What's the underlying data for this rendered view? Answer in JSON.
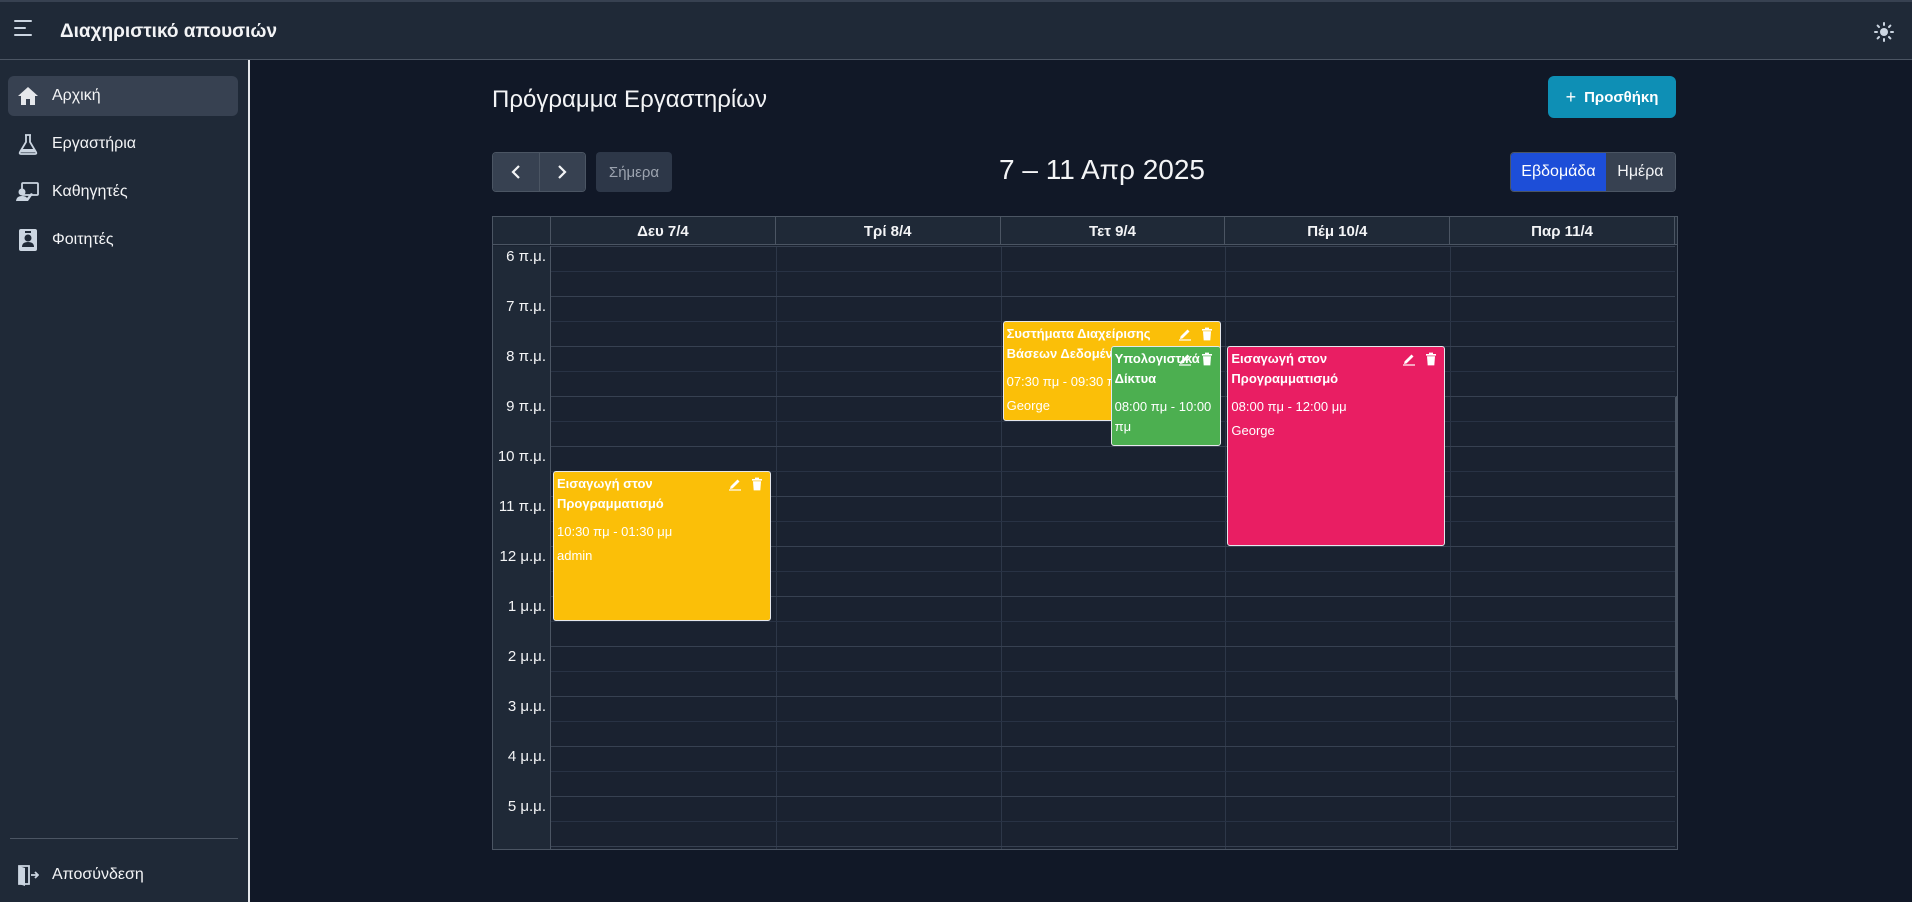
{
  "appbar": {
    "title": "Διαχηριστικό απουσιών",
    "menu_icon": "menu-icon",
    "theme_icon": "sun-icon"
  },
  "sidebar": {
    "items": [
      {
        "label": "Αρχική",
        "icon": "home-icon",
        "active": true
      },
      {
        "label": "Εργαστήρια",
        "icon": "flask-icon",
        "active": false
      },
      {
        "label": "Καθηγητές",
        "icon": "teacher-icon",
        "active": false
      },
      {
        "label": "Φοιτητές",
        "icon": "student-badge-icon",
        "active": false
      }
    ],
    "logout": {
      "label": "Αποσύνδεση",
      "icon": "logout-icon"
    }
  },
  "main": {
    "title": "Πρόγραμμα Εργαστηρίων",
    "add_button": "Προσθήκη",
    "today_button": "Σήμερα",
    "range": "7 – 11 Απρ 2025",
    "views": {
      "week": "Εβδομάδα",
      "day": "Ημέρα",
      "active": "week"
    }
  },
  "calendar": {
    "days": [
      "Δευ 7/4",
      "Τρί 8/4",
      "Τετ 9/4",
      "Πέμ 10/4",
      "Παρ 11/4"
    ],
    "hours": [
      "6 π.μ.",
      "7 π.μ.",
      "8 π.μ.",
      "9 π.μ.",
      "10 π.μ.",
      "11 π.μ.",
      "12 μ.μ.",
      "1 μ.μ.",
      "2 μ.μ.",
      "3 μ.μ.",
      "4 μ.μ.",
      "5 μ.μ."
    ],
    "events": [
      {
        "title": "Εισαγωγή στον Προγραμματισμό",
        "time": "10:30 πμ - 01:30 μμ",
        "who": "admin",
        "color": "#fbbf08",
        "day": 0,
        "start": 10.5,
        "end": 13.5
      },
      {
        "title": "Συστήματα Διαχείρισης Βάσεων Δεδομένων",
        "time": "07:30 πμ - 09:30 πμ",
        "who": "George",
        "color": "#fbbf08",
        "day": 2,
        "start": 7.5,
        "end": 9.5
      },
      {
        "title": "Υπολογιστικά Δίκτυα",
        "time": "08:00 πμ - 10:00 πμ",
        "who": "",
        "color": "#4caf50",
        "day": 2,
        "start": 8.0,
        "end": 10.0
      },
      {
        "title": "Εισαγωγή στον Προγραμματισμό",
        "time": "08:00 πμ - 12:00 μμ",
        "who": "George",
        "color": "#e91e63",
        "day": 3,
        "start": 8.0,
        "end": 12.0
      }
    ]
  }
}
